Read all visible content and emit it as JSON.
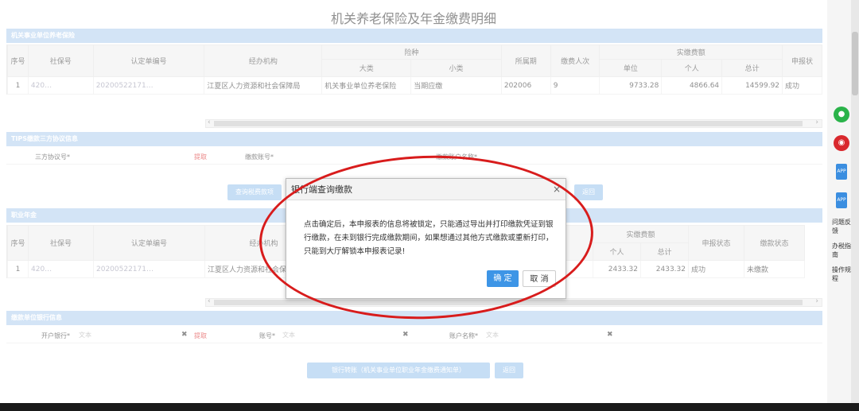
{
  "title": "机关养老保险及年金缴费明细",
  "section1": {
    "header": "机关事业单位养老保险",
    "headers": {
      "seq": "序号",
      "ss": "社保号",
      "cert": "认定单编号",
      "agency": "经办机构",
      "kind": "险种",
      "major": "大类",
      "minor": "小类",
      "period": "所属期",
      "count": "缴费人次",
      "actual": "实缴费额",
      "unit": "单位",
      "person": "个人",
      "total": "总计",
      "status": "申报状"
    },
    "row": {
      "seq": "1",
      "ss": "420…",
      "cert": "20200522171…",
      "agency": "江夏区人力资源和社会保障局",
      "major": "机关事业单位养老保险",
      "minor": "当期应缴",
      "period": "202006",
      "count": "9",
      "unit": "9733.28",
      "person": "4866.64",
      "total": "14599.92",
      "status": "成功"
    }
  },
  "tips": {
    "header": "TIPS缴款三方协议信息",
    "protocol_label": "三方协议号*",
    "fetch": "提取",
    "account_label": "缴款账号*",
    "account_name_label": "缴款账户名称*",
    "query_btn": "查询税费款项",
    "back_btn": "返回"
  },
  "section2": {
    "header": "职业年金",
    "headers": {
      "seq": "序号",
      "ss": "社保号",
      "cert": "认定单编号",
      "agency": "经办机构",
      "actual": "实缴费额",
      "person": "个人",
      "total": "总计",
      "status": "申报状态",
      "pay_status": "缴款状态"
    },
    "row": {
      "seq": "1",
      "ss": "420…",
      "cert": "20200522171…",
      "agency": "江夏区人力资源和社会保障局",
      "person": "2433.32",
      "total": "2433.32",
      "status": "成功",
      "pay_status": "未缴款"
    }
  },
  "bank": {
    "header": "缴款单位银行信息",
    "open_bank_label": "开户银行*",
    "placeholder": "文本",
    "fetch": "提取",
    "account_label": "账号*",
    "account_name_label": "账户名称*",
    "transfer_btn": "银行转账（机关事业单位职业年金缴费通知单）",
    "back_btn": "返回"
  },
  "dialog": {
    "title": "银行端查询缴款",
    "message": "点击确定后，本申报表的信息将被锁定，只能通过导出并打印缴款凭证到银行缴款，在未到银行完成缴款期间，如果想通过其他方式缴款或重新打印，只能到大厅解锁本申报表记录!",
    "ok": "确 定",
    "cancel": "取 消"
  },
  "sidebar": {
    "items": [
      "问题反馈",
      "办税指南",
      "操作规程"
    ]
  },
  "colors": {
    "section_bar": "#bcd6f2",
    "primary": "#3d95e6",
    "annotation": "#d81c1c"
  }
}
